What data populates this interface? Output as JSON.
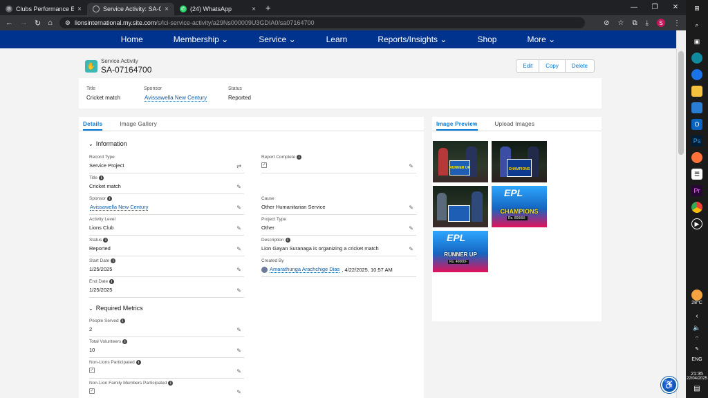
{
  "browser": {
    "tabs": [
      {
        "title": "Clubs Performance Evaluation D",
        "active": false,
        "icon": "settings-gear-icon"
      },
      {
        "title": "Service Activity: SA-07164700",
        "active": true,
        "icon": "globe-icon"
      },
      {
        "title": "(24) WhatsApp",
        "active": false,
        "icon": "whatsapp-icon"
      }
    ],
    "url_host": "lionsinternational.my.site.com",
    "url_path": "/s/lci-service-activity/a29Ns000009U3GDIA0/sa07164700"
  },
  "nav": {
    "items": [
      "Home",
      "Membership ⌄",
      "Service ⌄",
      "Learn",
      "Reports/Insights ⌄",
      "Shop",
      "More ⌄"
    ]
  },
  "record": {
    "type_label": "Service Activity",
    "name": "SA-07164700",
    "actions": [
      "Edit",
      "Copy",
      "Delete"
    ]
  },
  "highlights": {
    "title_label": "Title",
    "title_value": "Cricket match",
    "sponsor_label": "Sponsor",
    "sponsor_value": "Avissawella New Century",
    "status_label": "Status",
    "status_value": "Reported"
  },
  "main_tabs": [
    "Details",
    "Image Gallery"
  ],
  "sections": {
    "information": "Information",
    "required_metrics": "Required Metrics"
  },
  "fields": {
    "record_type": {
      "label": "Record Type",
      "value": "Service Project"
    },
    "report_complete": {
      "label": "Report Complete",
      "value": "✓"
    },
    "title": {
      "label": "Title",
      "value": "Cricket match"
    },
    "sponsor": {
      "label": "Sponsor",
      "value": "Avissawella New Century"
    },
    "cause": {
      "label": "Cause",
      "value": "Other Humanitarian Service"
    },
    "activity_level": {
      "label": "Activity Level",
      "value": "Lions Club"
    },
    "project_type": {
      "label": "Project Type",
      "value": "Other"
    },
    "status": {
      "label": "Status",
      "value": "Reported"
    },
    "description": {
      "label": "Description",
      "value": "Lion Gayan Suranaga is organizing a cricket match"
    },
    "start_date": {
      "label": "Start Date",
      "value": "1/25/2025"
    },
    "created_by": {
      "label": "Created By",
      "value": "Amarathunga Arachchige Dias",
      "suffix": ", 4/22/2025, 10:57 AM"
    },
    "end_date": {
      "label": "End Date",
      "value": "1/25/2025"
    },
    "people_served": {
      "label": "People Served",
      "value": "2"
    },
    "total_volunteers": {
      "label": "Total Volunteers",
      "value": "10"
    },
    "non_lions": {
      "label": "Non-Lions Participated",
      "value": "✓"
    },
    "non_lion_family": {
      "label": "Non-Lion Family Members Participated",
      "value": "✓"
    }
  },
  "side_tabs": [
    "Image Preview",
    "Upload Images"
  ],
  "gallery_texts": {
    "runner_up": "RUNNER UP",
    "champions": "CHAMPIONS",
    "champ_prize": "Rs. 80000/-",
    "ru_prize": "Rs. 40000/-",
    "epl": "EPL"
  },
  "taskbar": {
    "weather": "28°C",
    "lang": "ENG",
    "time": "21:35",
    "date": "22/04/2025"
  },
  "colors": {
    "nav": "#00338d",
    "link": "#0b5cab",
    "accent": "#0176d3"
  }
}
